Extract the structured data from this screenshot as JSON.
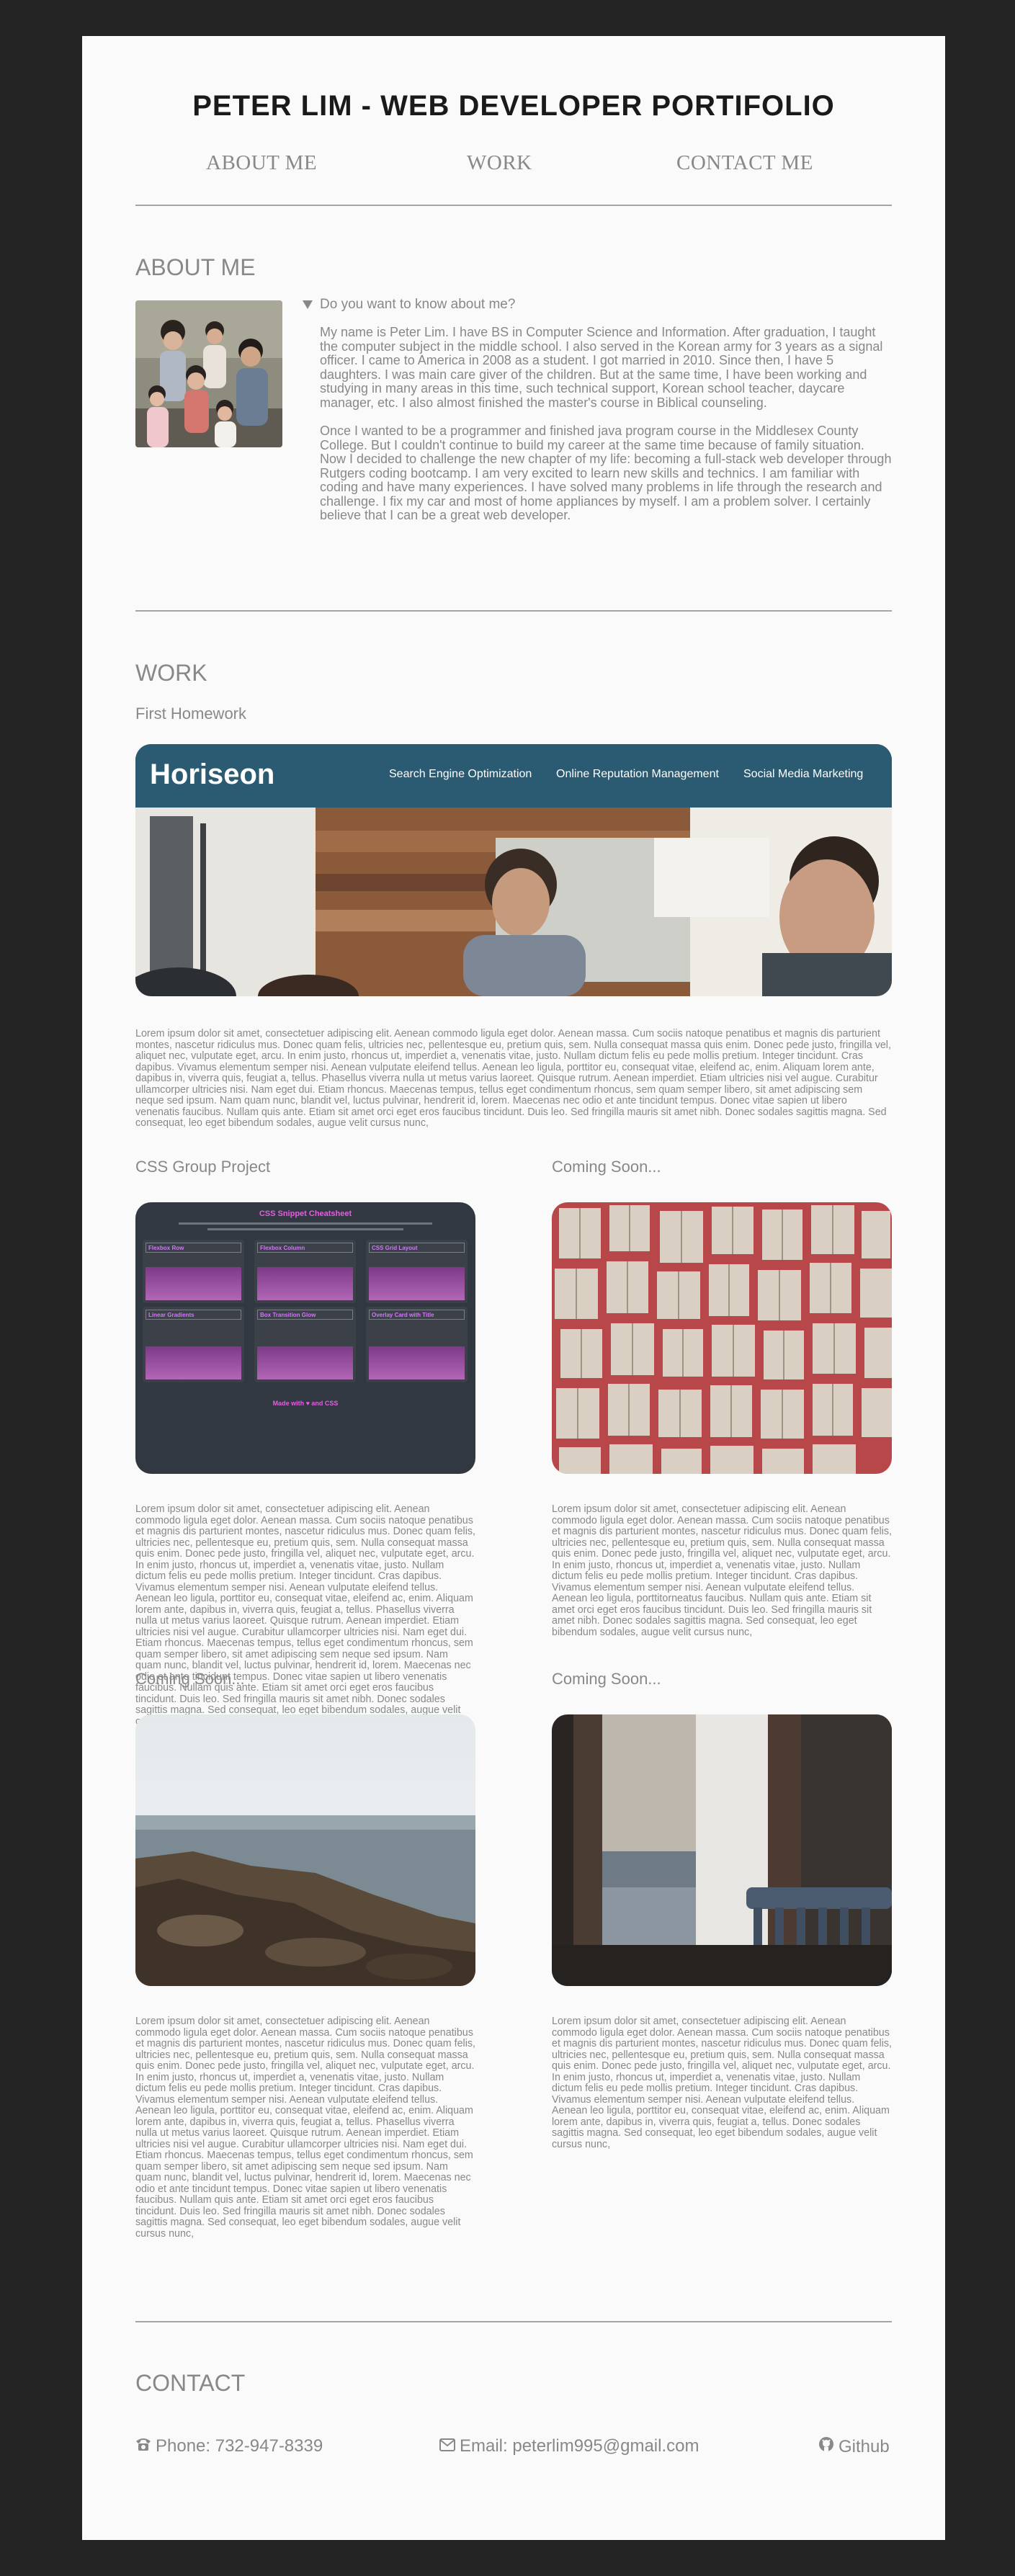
{
  "header": {
    "title": "PETER LIM - WEB DEVELOPER PORTIFOLIO",
    "nav": [
      "ABOUT ME",
      "WORK",
      "CONTACT ME"
    ]
  },
  "about": {
    "heading": "ABOUT ME",
    "summary": "Do you want to know about me?",
    "para1": "My name is Peter Lim. I have BS in Computer Science and Information. After graduation, I taught the computer subject in the middle school. I also served in the Korean army for 3 years as a signal officer. I came to America in 2008 as a student. I got married in 2010. Since then, I have 5 daughters. I was main care giver of the children. But at the same time, I have been working and studying in many areas in this time, such technical support, Korean school teacher, daycare manager, etc. I also almost finished the master's course in Biblical counseling.",
    "para2": "Once I wanted to be a programmer and finished java program course in the Middlesex County College. But I couldn't continue to build my career at the same time because of family situation. Now I decided to challenge the new chapter of my life: becoming a full-stack web developer through Rutgers coding bootcamp. I am very excited to learn new skills and technics. I am familiar with coding and have many experiences. I have solved many problems in life through the research and challenge. I fix my car and most of home appliances by myself. I am a problem solver. I certainly believe that I can be a great web developer."
  },
  "work": {
    "heading": "WORK",
    "first_label": "First Homework",
    "horiseon": {
      "brand": "Horiseon",
      "links": [
        "Search Engine Optimization",
        "Online Reputation Management",
        "Social Media Marketing"
      ]
    },
    "first_text": "Lorem ipsum dolor sit amet, consectetuer adipiscing elit. Aenean commodo ligula eget dolor. Aenean massa. Cum sociis natoque penatibus et magnis dis parturient montes, nascetur ridiculus mus. Donec quam felis, ultricies nec, pellentesque eu, pretium quis, sem. Nulla consequat massa quis enim. Donec pede justo, fringilla vel, aliquet nec, vulputate eget, arcu. In enim justo, rhoncus ut, imperdiet a, venenatis vitae, justo. Nullam dictum felis eu pede mollis pretium. Integer tincidunt. Cras dapibus. Vivamus elementum semper nisi. Aenean vulputate eleifend tellus. Aenean leo ligula, porttitor eu, consequat vitae, eleifend ac, enim. Aliquam lorem ante, dapibus in, viverra quis, feugiat a, tellus. Phasellus viverra nulla ut metus varius laoreet. Quisque rutrum. Aenean imperdiet. Etiam ultricies nisi vel augue. Curabitur ullamcorper ultricies nisi. Nam eget dui. Etiam rhoncus. Maecenas tempus, tellus eget condimentum rhoncus, sem quam semper libero, sit amet adipiscing sem neque sed ipsum. Nam quam nunc, blandit vel, luctus pulvinar, hendrerit id, lorem. Maecenas nec odio et ante tincidunt tempus. Donec vitae sapien ut libero venenatis faucibus. Nullam quis ante. Etiam sit amet orci eget eros faucibus tincidunt. Duis leo. Sed fringilla mauris sit amet nibh. Donec sodales sagittis magna. Sed consequat, leo eget bibendum sodales, augue velit cursus nunc,",
    "css_project": {
      "label": "CSS Group Project",
      "title": "CSS Snippet Cheatsheet",
      "cards": [
        "Flexbox Row",
        "Flexbox Column",
        "CSS Grid Layout",
        "Linear Gradients",
        "Box Transition Glow",
        "Overlay Card with Title"
      ],
      "footer": "Made with ♥ and CSS",
      "text": "Lorem ipsum dolor sit amet, consectetuer adipiscing elit. Aenean commodo ligula eget dolor. Aenean massa. Cum sociis natoque penatibus et magnis dis parturient montes, nascetur ridiculus mus. Donec quam felis, ultricies nec, pellentesque eu, pretium quis, sem. Nulla consequat massa quis enim. Donec pede justo, fringilla vel, aliquet nec, vulputate eget, arcu. In enim justo, rhoncus ut, imperdiet a, venenatis vitae, justo. Nullam dictum felis eu pede mollis pretium. Integer tincidunt. Cras dapibus. Vivamus elementum semper nisi. Aenean vulputate eleifend tellus. Aenean leo ligula, porttitor eu, consequat vitae, eleifend ac, enim. Aliquam lorem ante, dapibus in, viverra quis, feugiat a, tellus. Phasellus viverra nulla ut metus varius laoreet. Quisque rutrum. Aenean imperdiet. Etiam ultricies nisi vel augue. Curabitur ullamcorper ultricies nisi. Nam eget dui. Etiam rhoncus. Maecenas tempus, tellus eget condimentum rhoncus, sem quam semper libero, sit amet adipiscing sem neque sed ipsum. Nam quam nunc, blandit vel, luctus pulvinar, hendrerit id, lorem. Maecenas nec odio et ante tincidunt tempus. Donec vitae sapien ut libero venenatis faucibus. Nullam quis ante. Etiam sit amet orci eget eros faucibus tincidunt. Duis leo. Sed fringilla mauris sit amet nibh. Donec sodales sagittis magna. Sed consequat, leo eget bibendum sodales, augue velit cursus nunc,"
    },
    "soon1": {
      "label": "Coming Soon...",
      "text": "Lorem ipsum dolor sit amet, consectetuer adipiscing elit. Aenean commodo ligula eget dolor. Aenean massa. Cum sociis natoque penatibus et magnis dis parturient montes, nascetur ridiculus mus. Donec quam felis, ultricies nec, pellentesque eu, pretium quis, sem. Nulla consequat massa quis enim. Donec pede justo, fringilla vel, aliquet nec, vulputate eget, arcu. In enim justo, rhoncus ut, imperdiet a, venenatis vitae, justo. Nullam dictum felis eu pede mollis pretium. Integer tincidunt. Cras dapibus. Vivamus elementum semper nisi. Aenean vulputate eleifend tellus. Aenean leo ligula, porttitorneatus faucibus. Nullam quis ante. Etiam sit amet orci eget eros faucibus tincidunt. Duis leo. Sed fringilla mauris sit amet nibh. Donec sodales sagittis magna. Sed consequat, leo eget bibendum sodales, augue velit cursus nunc,"
    },
    "soon2": {
      "label": "Coming Soon...",
      "text": "Lorem ipsum dolor sit amet, consectetuer adipiscing elit. Aenean commodo ligula eget dolor. Aenean massa. Cum sociis natoque penatibus et magnis dis parturient montes, nascetur ridiculus mus. Donec quam felis, ultricies nec, pellentesque eu, pretium quis, sem. Nulla consequat massa quis enim. Donec pede justo, fringilla vel, aliquet nec, vulputate eget, arcu. In enim justo, rhoncus ut, imperdiet a, venenatis vitae, justo. Nullam dictum felis eu pede mollis pretium. Integer tincidunt. Cras dapibus. Vivamus elementum semper nisi. Aenean vulputate eleifend tellus. Aenean leo ligula, porttitor eu, consequat vitae, eleifend ac, enim. Aliquam lorem ante, dapibus in, viverra quis, feugiat a, tellus. Phasellus viverra nulla ut metus varius laoreet. Quisque rutrum. Aenean imperdiet. Etiam ultricies nisi vel augue. Curabitur ullamcorper ultricies nisi. Nam eget dui. Etiam rhoncus. Maecenas tempus, tellus eget condimentum rhoncus, sem quam semper libero, sit amet adipiscing sem neque sed ipsum. Nam quam nunc, blandit vel, luctus pulvinar, hendrerit id, lorem. Maecenas nec odio et ante tincidunt tempus. Donec vitae sapien ut libero venenatis faucibus. Nullam quis ante. Etiam sit amet orci eget eros faucibus tincidunt. Duis leo. Sed fringilla mauris sit amet nibh. Donec sodales sagittis magna. Sed consequat, leo eget bibendum sodales, augue velit cursus nunc,"
    },
    "soon3": {
      "label": "Coming Soon...",
      "text": "Lorem ipsum dolor sit amet, consectetuer adipiscing elit. Aenean commodo ligula eget dolor. Aenean massa. Cum sociis natoque penatibus et magnis dis parturient montes, nascetur ridiculus mus. Donec quam felis, ultricies nec, pellentesque eu, pretium quis, sem. Nulla consequat massa quis enim. Donec pede justo, fringilla vel, aliquet nec, vulputate eget, arcu. In enim justo, rhoncus ut, imperdiet a, venenatis vitae, justo. Nullam dictum felis eu pede mollis pretium. Integer tincidunt. Cras dapibus. Vivamus elementum semper nisi. Aenean vulputate eleifend tellus. Aenean leo ligula, porttitor eu, consequat vitae, eleifend ac, enim. Aliquam lorem ante, dapibus in, viverra quis, feugiat a, tellus. Donec sodales sagittis magna. Sed consequat, leo eget bibendum sodales, augue velit cursus nunc,"
    }
  },
  "contact": {
    "heading": "CONTACT",
    "phone": "Phone: 732-947-8339",
    "email": "Email: peterlim995@gmail.com",
    "github": "Github"
  }
}
